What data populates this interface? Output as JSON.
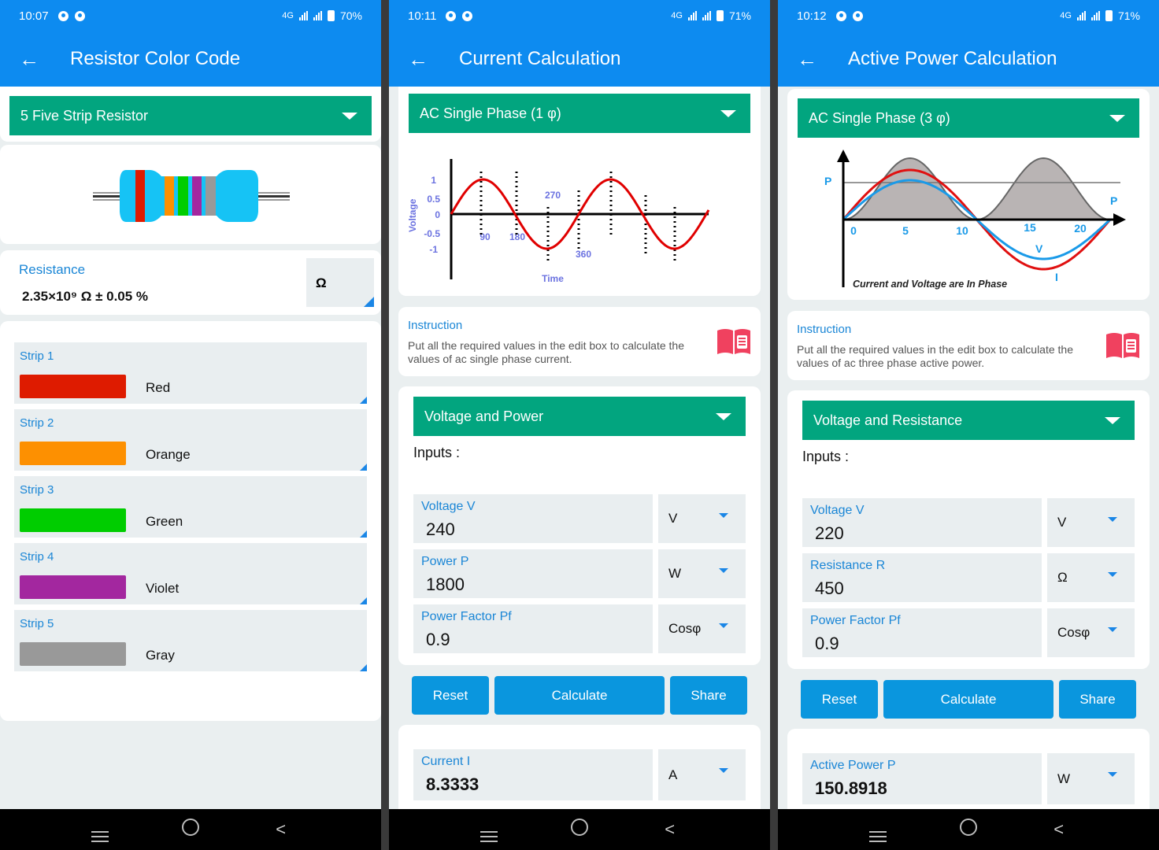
{
  "colors": {
    "primary": "#0d8bf0",
    "green_header": "#02a57f",
    "button": "#0a96de",
    "label_blue": "#1a86d6",
    "book_red": "#f0415f"
  },
  "screens": [
    {
      "status": {
        "time": "10:07",
        "network": "4G",
        "battery": "70%"
      },
      "title": "Resistor Color Code",
      "back_icon": "arrow-left-icon",
      "dropdown": "5 Five Strip Resistor",
      "resistance": {
        "label": "Resistance",
        "value": "2.35×10⁹ Ω  ± 0.05 %",
        "unit": "Ω"
      },
      "strips": [
        {
          "label": "Strip 1",
          "color_name": "Red",
          "color": "#de1b00"
        },
        {
          "label": "Strip 2",
          "color_name": "Orange",
          "color": "#fd9001"
        },
        {
          "label": "Strip 3",
          "color_name": "Green",
          "color": "#00cd00"
        },
        {
          "label": "Strip 4",
          "color_name": "Violet",
          "color": "#a3279f"
        },
        {
          "label": "Strip 5",
          "color_name": "Gray",
          "color": "#999999"
        }
      ]
    },
    {
      "status": {
        "time": "10:11",
        "network": "4G",
        "battery": "71%"
      },
      "title": "Current Calculation",
      "back_icon": "arrow-left-icon",
      "dropdown": "AC Single Phase (1 φ)",
      "diagram": {
        "ylabel": "Voltage",
        "xlabel": "Time",
        "yticks": [
          "1",
          "0.5",
          "0",
          "-0.5",
          "-1"
        ],
        "xticks": [
          "90",
          "180",
          "270",
          "360"
        ]
      },
      "instruction": {
        "title": "Instruction",
        "text": "Put all the required values in the edit box to calculate the values of ac single phase current."
      },
      "mode_dropdown": "Voltage and Power",
      "inputs_label": "Inputs :",
      "inputs": [
        {
          "label": "Voltage V",
          "value": "240",
          "unit": "V"
        },
        {
          "label": "Power P",
          "value": "1800",
          "unit": "W"
        },
        {
          "label": "Power Factor Pf",
          "value": "0.9",
          "unit": "Cosφ"
        }
      ],
      "buttons": {
        "reset": "Reset",
        "calculate": "Calculate",
        "share": "Share"
      },
      "result": {
        "label": "Current I",
        "value": "8.3333",
        "unit": "A"
      }
    },
    {
      "status": {
        "time": "10:12",
        "network": "4G",
        "battery": "71%"
      },
      "title": "Active Power Calculation",
      "back_icon": "arrow-left-icon",
      "dropdown": "AC Single Phase (3 φ)",
      "diagram": {
        "caption": "Current and Voltage are In Phase",
        "p_label": "P",
        "p_axis_label": "P",
        "v_label": "V",
        "i_label": "I",
        "xticks": [
          "0",
          "5",
          "10",
          "15",
          "20"
        ]
      },
      "instruction": {
        "title": "Instruction",
        "text": "Put all the required values in the edit box to calculate the values of ac three phase active power."
      },
      "mode_dropdown": "Voltage and Resistance",
      "inputs_label": "Inputs :",
      "inputs": [
        {
          "label": "Voltage V",
          "value": "220",
          "unit": "V"
        },
        {
          "label": "Resistance R",
          "value": "450",
          "unit": "Ω"
        },
        {
          "label": "Power Factor Pf",
          "value": "0.9",
          "unit": "Cosφ"
        }
      ],
      "buttons": {
        "reset": "Reset",
        "calculate": "Calculate",
        "share": "Share"
      },
      "result": {
        "label": "Active Power P",
        "value": "150.8918",
        "unit": "W"
      }
    }
  ]
}
